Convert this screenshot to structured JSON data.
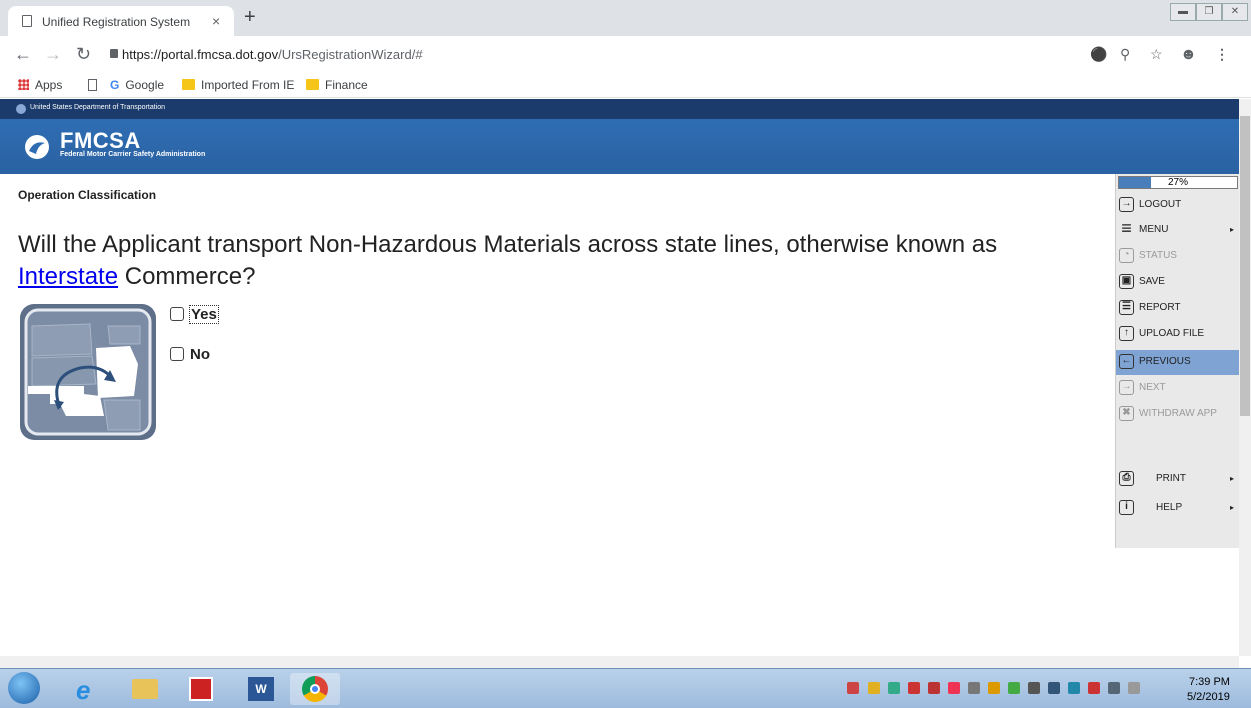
{
  "browser": {
    "tab_title": "Unified Registration System",
    "tab_close": "×",
    "new_tab": "+",
    "url_host": "https://portal.fmcsa.dot.gov",
    "url_path": "/UrsRegistrationWizard/#",
    "bookmarks": [
      "Apps",
      "Google",
      "Imported From IE",
      "Finance"
    ]
  },
  "header": {
    "dept": "United States Department of Transportation",
    "logo": "FMCSA",
    "subtitle": "Federal Motor Carrier Safety Administration"
  },
  "page": {
    "section_title": "Operation Classification",
    "question_pre": "Will the Applicant transport Non-Hazardous Materials across state lines, otherwise known as ",
    "question_link": "Interstate",
    "question_post": " Commerce?",
    "options": [
      "Yes",
      "No"
    ]
  },
  "sidemenu": {
    "progress_text": "27%",
    "progress_fraction": 0.27,
    "items": [
      {
        "label": "LOGOUT",
        "icon": "logout-icon",
        "state": "normal"
      },
      {
        "label": "MENU",
        "icon": "hamburger-icon",
        "state": "normal"
      },
      {
        "label": "STATUS",
        "icon": "status-icon",
        "state": "disabled"
      },
      {
        "label": "SAVE",
        "icon": "save-icon",
        "state": "normal"
      },
      {
        "label": "REPORT",
        "icon": "report-icon",
        "state": "normal"
      },
      {
        "label": "UPLOAD FILE",
        "icon": "upload-icon",
        "state": "normal"
      },
      {
        "label": "PREVIOUS",
        "icon": "previous-icon",
        "state": "active"
      },
      {
        "label": "NEXT",
        "icon": "next-icon",
        "state": "disabled"
      },
      {
        "label": "WITHDRAW APP",
        "icon": "withdraw-icon",
        "state": "disabled"
      },
      {
        "label": "PRINT",
        "icon": "print-icon",
        "state": "normal"
      },
      {
        "label": "HELP",
        "icon": "help-icon",
        "state": "normal"
      }
    ]
  },
  "taskbar": {
    "time": "7:39 PM",
    "date": "5/2/2019"
  },
  "colors": {
    "header_blue": "#2f6db3",
    "dot_bar": "#1a3b6c",
    "active_menu": "#7fa4d3",
    "link": "#0000ee"
  }
}
